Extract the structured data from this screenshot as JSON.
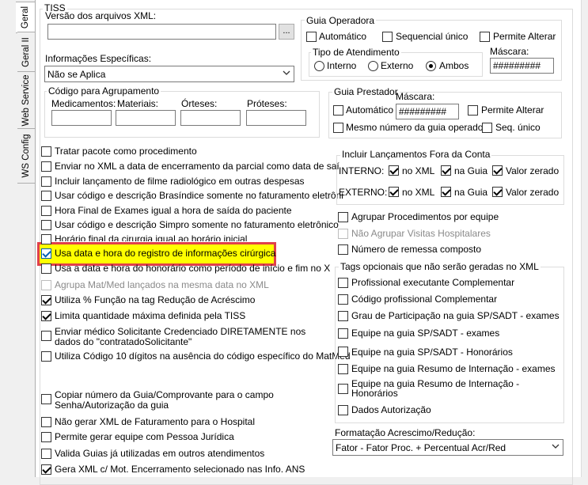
{
  "tabs": [
    "Geral",
    "Geral II",
    "Web Service",
    "WS Config"
  ],
  "tiss_title": "TISS",
  "versao": {
    "label": "Versão dos arquivos XML:",
    "value": "",
    "browse": "..."
  },
  "info": {
    "label": "Informações Específicas:",
    "value": "Não se Aplica"
  },
  "guia_operadora": {
    "title": "Guia Operadora",
    "automatico": "Automático",
    "sequencial": "Sequencial único",
    "permite": "Permite Alterar",
    "tipo_title": "Tipo de Atendimento",
    "interno": "Interno",
    "externo": "Externo",
    "ambos": "Ambos",
    "mascara_label": "Máscara:",
    "mascara_value": "#########"
  },
  "codigo_agrup": {
    "title": "Código para Agrupamento",
    "medicamentos": "Medicamentos:",
    "materiais": "Materiais:",
    "orteses": "Órteses:",
    "proteses": "Próteses:"
  },
  "guia_prestador": {
    "title": "Guia Prestador",
    "automatico": "Automático",
    "mascara_label": "Máscara:",
    "mascara_value": "#########",
    "permite": "Permite Alterar",
    "mesmo": "Mesmo número da guia operadora",
    "seq": "Seq. único"
  },
  "left_options": [
    "Tratar pacote como procedimento",
    "Enviar no XML a data de encerramento da parcial como data de saí",
    "Incluir lançamento de filme radiológico em outras despesas",
    "Usar código e descrição Brasíndice somente no faturamento eletrôni",
    "Hora Final de Exames igual a hora de saída do paciente",
    "Usar código e descrição Simpro somente no faturamento eletrônico",
    "Horário final da cirurgia igual ao horário inicial",
    "Usa data e hora do registro de informações cirúrgica",
    "Usa a data e hora do honorário como período de início e fim no X",
    "Agrupa Mat/Med lançados na mesma data no XML",
    "Utiliza % Função na tag Redução de Acréscimo",
    "Limita quantidade máxima definida pela TISS",
    "Enviar médico Solicitante Credenciado DIRETAMENTE nos",
    "dados do \"contratadoSolicitante\"",
    "Utiliza Código 10 dígitos na ausência do código específico do MatMed",
    "Copiar número da Guia/Comprovante para o campo",
    "Senha/Autorização da guia",
    "Não gerar XML de Faturamento para o Hospital",
    "Permite gerar equipe com Pessoa Jurídica",
    "Valida Guias já utilizadas em outros atendimentos",
    "Gera XML c/ Mot. Encerramento selecionado nas Info. ANS"
  ],
  "fora_conta": {
    "title": "Incluir Lançamentos Fora da Conta",
    "interno": "INTERNO:",
    "externo": "EXTERNO:",
    "no_xml": "no XML",
    "na_guia": "na Guia",
    "valor_zerado": "Valor zerado"
  },
  "agrup_options": [
    "Agrupar Procedimentos por equipe",
    "Não Agrupar Visitas Hospitalares",
    "Número de remessa composto"
  ],
  "tags": {
    "title": "Tags opcionais que não serão geradas no XML",
    "items": [
      "Profissional executante Complementar",
      "Código profissional Complementar",
      "Grau de Participação na guia SP/SADT - exames",
      "Equipe na guia SP/SADT - exames",
      "Equipe na guia SP/SADT - Honorários",
      "Equipe na guia Resumo de Internação - exames",
      "Equipe na guia Resumo de Internação -",
      "Honorários",
      "Dados Autorização"
    ]
  },
  "formatacao": {
    "label": "Formatação Acrescimo/Redução:",
    "value": "Fator - Fator Proc. + Percentual Acr/Red"
  }
}
